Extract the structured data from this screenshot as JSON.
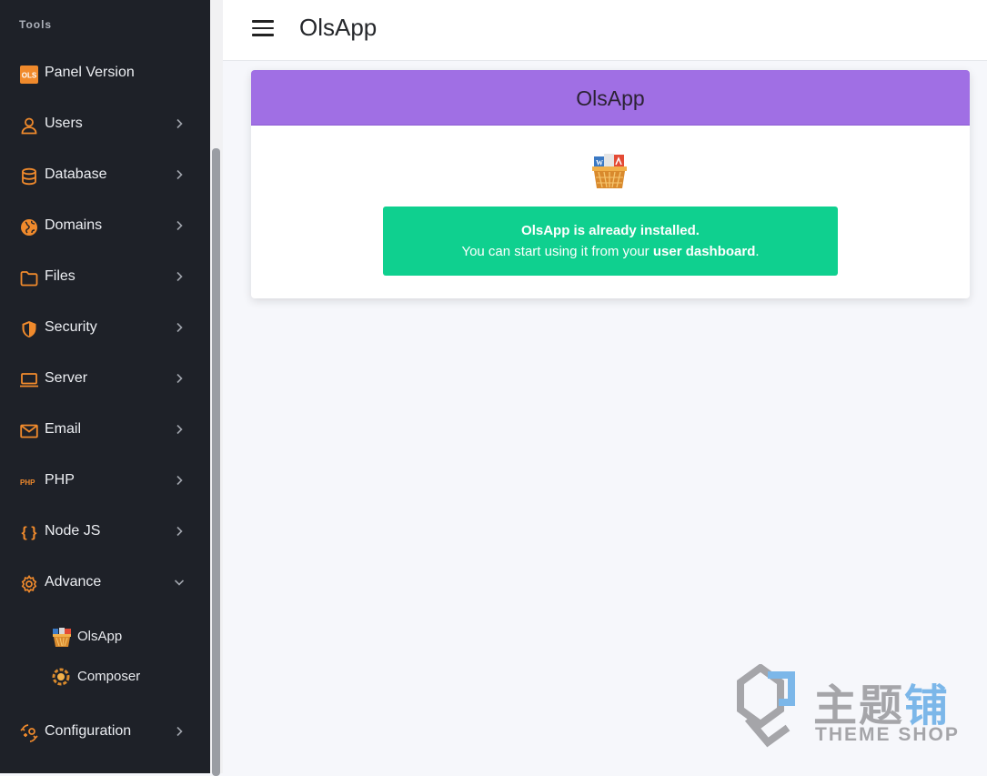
{
  "sidebar": {
    "section_label": "Tools",
    "items": [
      {
        "label": "Panel Version",
        "icon": "ols-logo-icon"
      },
      {
        "label": "Users",
        "icon": "user-icon"
      },
      {
        "label": "Database",
        "icon": "database-icon"
      },
      {
        "label": "Domains",
        "icon": "globe-icon"
      },
      {
        "label": "Files",
        "icon": "folder-icon"
      },
      {
        "label": "Security",
        "icon": "shield-icon"
      },
      {
        "label": "Server",
        "icon": "laptop-icon"
      },
      {
        "label": "Email",
        "icon": "envelope-icon"
      },
      {
        "label": "PHP",
        "icon": "php-icon",
        "icon_text": "PHP"
      },
      {
        "label": "Node JS",
        "icon": "curly-braces-icon",
        "icon_text": "{ }"
      },
      {
        "label": "Advance",
        "icon": "gear-icon",
        "expanded": true
      },
      {
        "label": "Configuration",
        "icon": "sync-settings-icon"
      }
    ],
    "sub_items": [
      {
        "label": "OlsApp",
        "icon": "olsapp-basket-icon"
      },
      {
        "label": "Composer",
        "icon": "composer-icon"
      }
    ],
    "icon_color": "#f08a2c"
  },
  "header": {
    "title": "OlsApp"
  },
  "card": {
    "title": "OlsApp",
    "header_color": "#a06fe4",
    "alert": {
      "line1": "OlsApp is already installed.",
      "line2_prefix": "You can start using it from your ",
      "line2_link": "user dashboard",
      "line2_suffix": ".",
      "color": "#0fd08f"
    }
  },
  "watermark": {
    "cn_a": "主题",
    "cn_b": "铺",
    "en": "THEME SHOP"
  }
}
